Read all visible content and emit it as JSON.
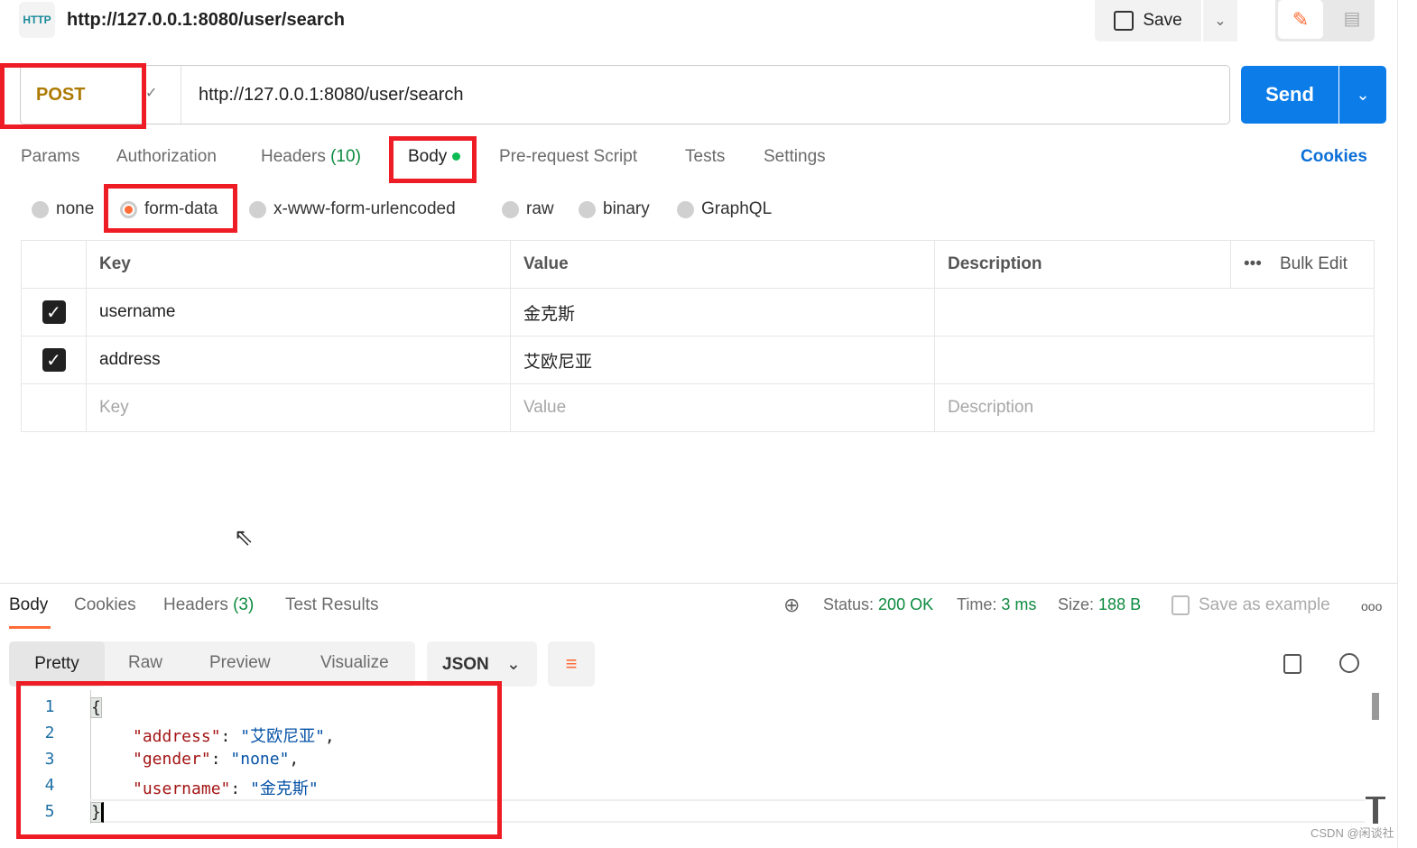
{
  "header": {
    "title": "http://127.0.0.1:8080/user/search",
    "icon": "http-icon",
    "save_label": "Save"
  },
  "request": {
    "method": "POST",
    "method_color": "#ad7a03",
    "url": "http://127.0.0.1:8080/user/search",
    "send_label": "Send",
    "send_color": "#0c7de8"
  },
  "tabs": [
    {
      "label": "Params"
    },
    {
      "label": "Authorization"
    },
    {
      "label": "Headers",
      "count": "(10)"
    },
    {
      "label": "Body",
      "active": true
    },
    {
      "label": "Pre-request Script"
    },
    {
      "label": "Tests"
    },
    {
      "label": "Settings"
    }
  ],
  "cookies_label": "Cookies",
  "body_types": [
    {
      "label": "none"
    },
    {
      "label": "form-data",
      "selected": true
    },
    {
      "label": "x-www-form-urlencoded"
    },
    {
      "label": "raw"
    },
    {
      "label": "binary"
    },
    {
      "label": "GraphQL"
    }
  ],
  "form_table": {
    "headers": [
      "Key",
      "Value",
      "Description"
    ],
    "bulk_edit": "Bulk Edit",
    "rows": [
      {
        "checked": true,
        "key": "username",
        "value": "金克斯",
        "description": ""
      },
      {
        "checked": true,
        "key": "address",
        "value": "艾欧尼亚",
        "description": ""
      }
    ],
    "placeholders": {
      "key": "Key",
      "value": "Value",
      "description": "Description"
    }
  },
  "response": {
    "tabs": [
      {
        "label": "Body",
        "active": true
      },
      {
        "label": "Cookies"
      },
      {
        "label": "Headers",
        "count": "(3)"
      },
      {
        "label": "Test Results"
      }
    ],
    "status_label": "Status:",
    "status": "200 OK",
    "time_label": "Time:",
    "time": "3 ms",
    "size_label": "Size:",
    "size": "188 B",
    "save_example": "Save as example",
    "view_tabs": [
      "Pretty",
      "Raw",
      "Preview",
      "Visualize"
    ],
    "format": "JSON",
    "lines": [
      {
        "n": "1",
        "text": "{"
      },
      {
        "n": "2",
        "key": "\"address\"",
        "val": "\"艾欧尼亚\"",
        "comma": ","
      },
      {
        "n": "3",
        "key": "\"gender\"",
        "val": "\"none\"",
        "comma": ","
      },
      {
        "n": "4",
        "key": "\"username\"",
        "val": "\"金克斯\"",
        "comma": ""
      },
      {
        "n": "5",
        "text": "}"
      }
    ]
  },
  "watermark": "CSDN @闲谈社"
}
